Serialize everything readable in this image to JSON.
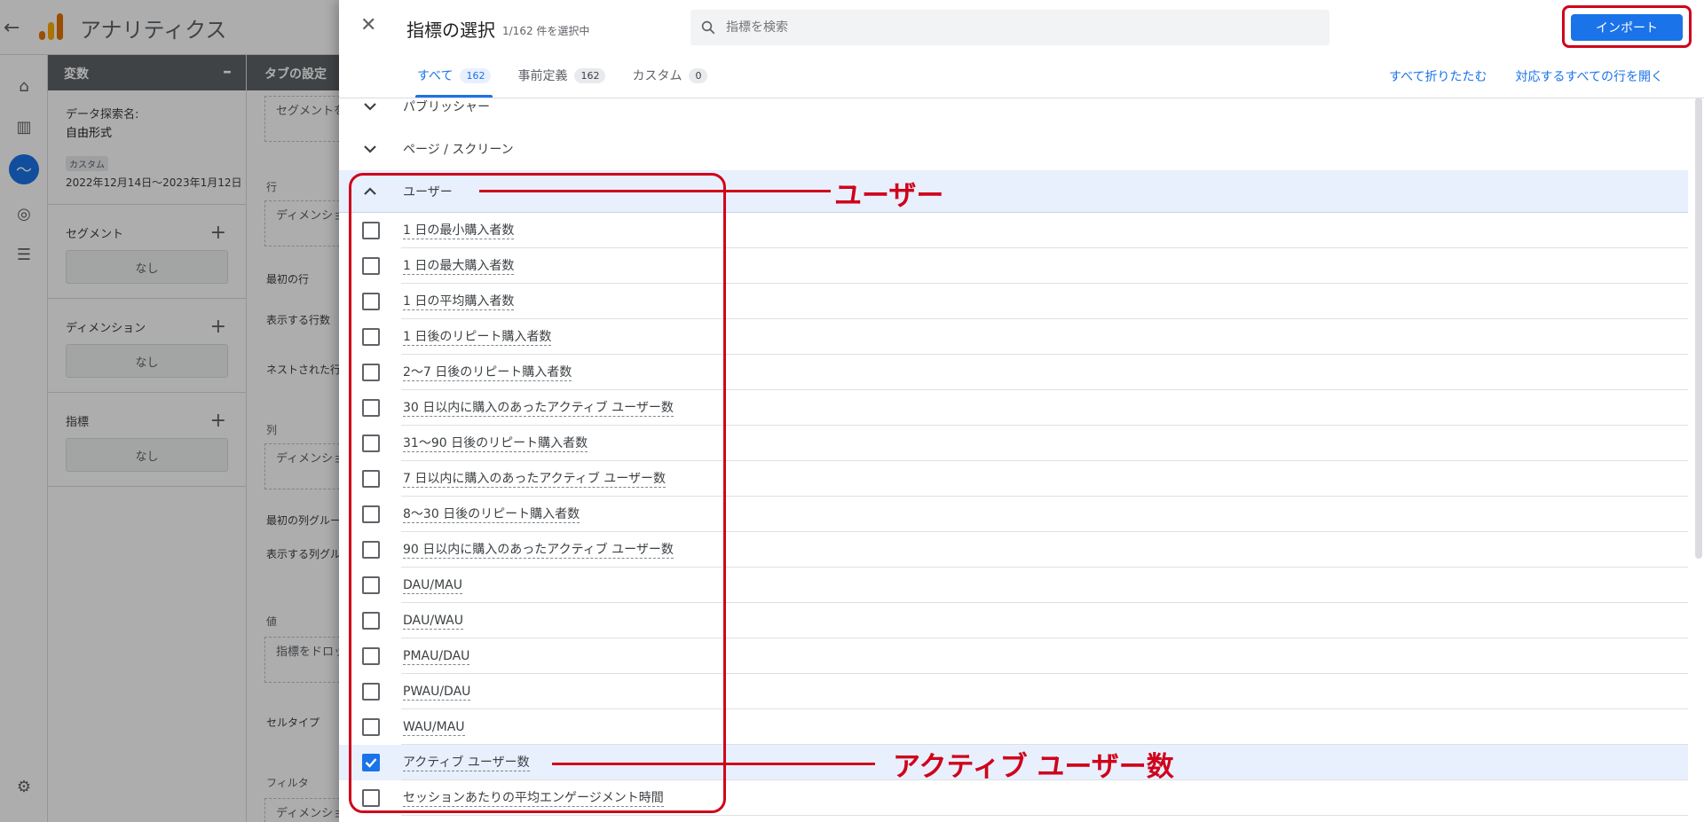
{
  "app": {
    "title": "アナリティクス",
    "variables_panel": {
      "header": "変数",
      "exploration_name_label": "データ探索名:",
      "exploration_name_value": "自由形式",
      "date_badge": "カスタム",
      "date_range": "2022年12月14日～2023年1月12日",
      "segments_label": "セグメント",
      "segments_value": "なし",
      "dimensions_label": "ディメンション",
      "dimensions_value": "なし",
      "metrics_label": "指標",
      "metrics_value": "なし"
    },
    "tab_panel": {
      "header": "タブの設定",
      "segment_drop": "セグメントを ドロップするか選択し",
      "rows_label": "行",
      "rows_drop": "ディメンションを ドロップするか選択",
      "first_row": "最初の行",
      "show_rows": "表示する行数",
      "nested_rows": "ネストされた行",
      "columns_label": "列",
      "columns_drop": "ディメンションを ドロップするか選択",
      "first_col_group": "最初の列グループ",
      "show_col_groups": "表示する列グループ数",
      "values_label": "値",
      "values_drop": "指標をドロップ するか選択して",
      "cell_type": "セルタイプ",
      "filters_label": "フィルタ",
      "filters_drop": "ディメンションを"
    }
  },
  "dialog": {
    "title": "指標の選択",
    "selected_count": "1/162 件を選択中",
    "search_placeholder": "指標を検索",
    "import_label": "インポート",
    "tabs": [
      {
        "label": "すべて",
        "count": "162"
      },
      {
        "label": "事前定義",
        "count": "162"
      },
      {
        "label": "カスタム",
        "count": "0"
      }
    ],
    "collapse_all": "すべて折りたたむ",
    "expand_matching": "対応するすべての行を開く",
    "groups": [
      {
        "label": "パブリッシャー",
        "expanded": false
      },
      {
        "label": "ページ / スクリーン",
        "expanded": false
      },
      {
        "label": "ユーザー",
        "expanded": true
      }
    ],
    "items": [
      {
        "label": "1 日の最小購入者数",
        "checked": false
      },
      {
        "label": "1 日の最大購入者数",
        "checked": false
      },
      {
        "label": "1 日の平均購入者数",
        "checked": false
      },
      {
        "label": "1 日後のリピート購入者数",
        "checked": false
      },
      {
        "label": "2～7 日後のリピート購入者数",
        "checked": false
      },
      {
        "label": "30 日以内に購入のあったアクティブ ユーザー数",
        "checked": false
      },
      {
        "label": "31～90 日後のリピート購入者数",
        "checked": false
      },
      {
        "label": "7 日以内に購入のあったアクティブ ユーザー数",
        "checked": false
      },
      {
        "label": "8～30 日後のリピート購入者数",
        "checked": false
      },
      {
        "label": "90 日以内に購入のあったアクティブ ユーザー数",
        "checked": false
      },
      {
        "label": "DAU/MAU",
        "checked": false
      },
      {
        "label": "DAU/WAU",
        "checked": false
      },
      {
        "label": "PMAU/DAU",
        "checked": false
      },
      {
        "label": "PWAU/DAU",
        "checked": false
      },
      {
        "label": "WAU/MAU",
        "checked": false
      },
      {
        "label": "アクティブ ユーザー数",
        "checked": true
      },
      {
        "label": "セッションあたりの平均エンゲージメント時間",
        "checked": false
      }
    ]
  },
  "annotations": {
    "user_callout": "ユーザー",
    "active_users_callout": "アクティブ ユーザー数",
    "color": "#d0021b"
  },
  "colors": {
    "accent": "#1a73e8",
    "selected_row": "#e8f0fe"
  }
}
